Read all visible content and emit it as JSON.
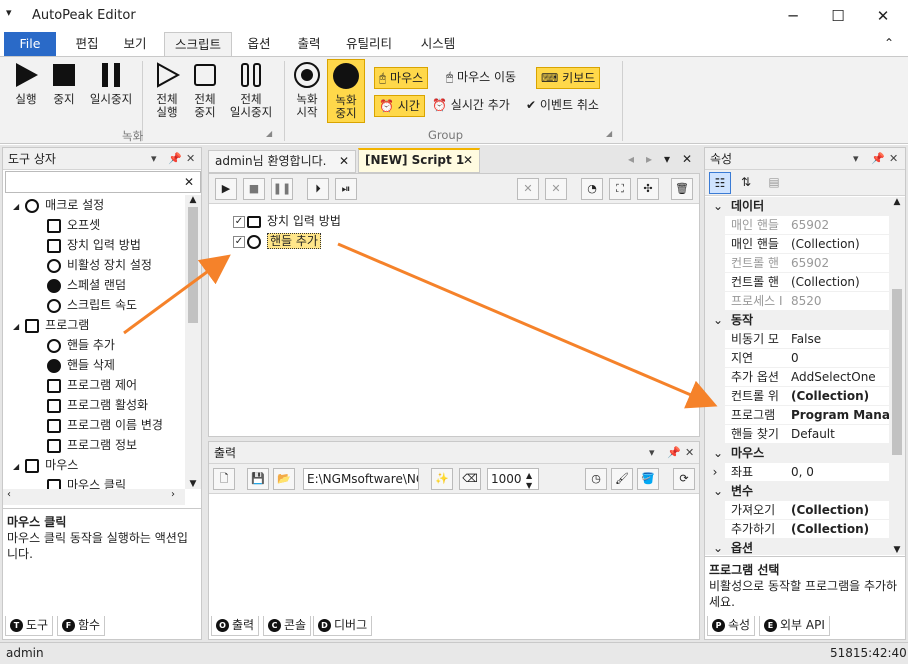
{
  "app": {
    "title": "AutoPeak Editor"
  },
  "ribbon_tabs": [
    "File",
    "편집",
    "보기",
    "스크립트",
    "옵션",
    "출력",
    "유틸리티",
    "시스템"
  ],
  "ribbon": {
    "record_group_label": "녹화",
    "group2_label": "Group",
    "run": "실행",
    "stop": "중지",
    "pause": "일시중지",
    "all_run": [
      "전체",
      "실행"
    ],
    "all_stop": [
      "전체",
      "중지"
    ],
    "all_pause": [
      "전체",
      "일시중지"
    ],
    "rec_start": [
      "녹화",
      "시작"
    ],
    "rec_stop": [
      "녹화",
      "중지"
    ],
    "mouse": "마우스",
    "mouse_move": "마우스 이동",
    "keyboard": "키보드",
    "time": "시간",
    "realtime_add": "실시간 추가",
    "event_cancel": "이벤트 취소"
  },
  "toolbox": {
    "title": "도구 상자",
    "items": [
      {
        "label": "매크로 설정",
        "level": 0,
        "icon": "globe-icon"
      },
      {
        "label": "오프셋",
        "level": 1,
        "icon": "offset-icon"
      },
      {
        "label": "장치 입력 방법",
        "level": 1,
        "icon": "device-input-icon"
      },
      {
        "label": "비활성 장치 설정",
        "level": 1,
        "icon": "crosshair-icon"
      },
      {
        "label": "스페셜 랜덤",
        "level": 1,
        "icon": "infinity-icon"
      },
      {
        "label": "스크립트 속도",
        "level": 1,
        "icon": "speed-icon"
      },
      {
        "label": "프로그램",
        "level": 0,
        "icon": "program-icon"
      },
      {
        "label": "핸들 추가",
        "level": 1,
        "icon": "crosshair-icon"
      },
      {
        "label": "핸들 삭제",
        "level": 1,
        "icon": "handle-delete-icon"
      },
      {
        "label": "프로그램 제어",
        "level": 1,
        "icon": "laptop-icon"
      },
      {
        "label": "프로그램 활성화",
        "level": 1,
        "icon": "activate-icon"
      },
      {
        "label": "프로그램 이름 변경",
        "level": 1,
        "icon": "rename-icon"
      },
      {
        "label": "프로그램 정보",
        "level": 1,
        "icon": "search-icon"
      },
      {
        "label": "마우스",
        "level": 0,
        "icon": "mouse-icon"
      },
      {
        "label": "마우스 클릭",
        "level": 1,
        "icon": "click-icon"
      }
    ],
    "desc_title": "마우스 클릭",
    "desc_text": "마우스 클릭 동작을 실행하는 액션입니다.",
    "tabs": [
      "도구",
      "함수"
    ]
  },
  "editor": {
    "tabs": [
      "admin님 환영합니다.",
      "[NEW] Script 1"
    ],
    "script_items": [
      "장치 입력 방법",
      "핸들 추가"
    ]
  },
  "output": {
    "title": "출력",
    "path": "E:\\NGMsoftware\\NG",
    "number": "1000",
    "tabs": [
      "출력",
      "콘솔",
      "디버그"
    ]
  },
  "properties": {
    "title": "속성",
    "rows": [
      {
        "type": "cat",
        "name": "데이터"
      },
      {
        "type": "prop",
        "name": "매인 핸들",
        "value": "65902",
        "muted": true
      },
      {
        "type": "prop",
        "name": "매인 핸들",
        "value": "(Collection)"
      },
      {
        "type": "prop",
        "name": "컨트롤 핸",
        "value": "65902",
        "muted": true
      },
      {
        "type": "prop",
        "name": "컨트롤 핸",
        "value": "(Collection)"
      },
      {
        "type": "prop",
        "name": "프로세스 I",
        "value": "8520",
        "muted": true
      },
      {
        "type": "cat",
        "name": "동작"
      },
      {
        "type": "prop",
        "name": "비동기 모",
        "value": "False"
      },
      {
        "type": "prop",
        "name": "지연",
        "value": "0"
      },
      {
        "type": "prop",
        "name": "추가 옵션",
        "value": "AddSelectOne"
      },
      {
        "type": "prop",
        "name": "컨트롤 위",
        "value": "(Collection)",
        "bold": true
      },
      {
        "type": "prop",
        "name": "프로그램",
        "value": "Program Manag",
        "bold": true
      },
      {
        "type": "prop",
        "name": "핸들 찾기",
        "value": "Default"
      },
      {
        "type": "cat",
        "name": "마우스"
      },
      {
        "type": "prop",
        "name": "좌표",
        "value": "0, 0",
        "expand": true
      },
      {
        "type": "cat",
        "name": "변수"
      },
      {
        "type": "prop",
        "name": "가져오기",
        "value": "(Collection)",
        "bold": true
      },
      {
        "type": "prop",
        "name": "추가하기",
        "value": "(Collection)",
        "bold": true
      },
      {
        "type": "cat",
        "name": "옵션"
      }
    ],
    "desc_title": "프로그램 선택",
    "desc_text": "비활성으로 동작할 프로그램을 추가하세요.",
    "tabs": [
      "속성",
      "외부 API"
    ]
  },
  "status": {
    "user": "admin",
    "clock": "51815:42:40"
  },
  "colors": {
    "accent": "#2a6ac8",
    "highlight": "#ffd84a",
    "arrow": "#f5822a"
  }
}
